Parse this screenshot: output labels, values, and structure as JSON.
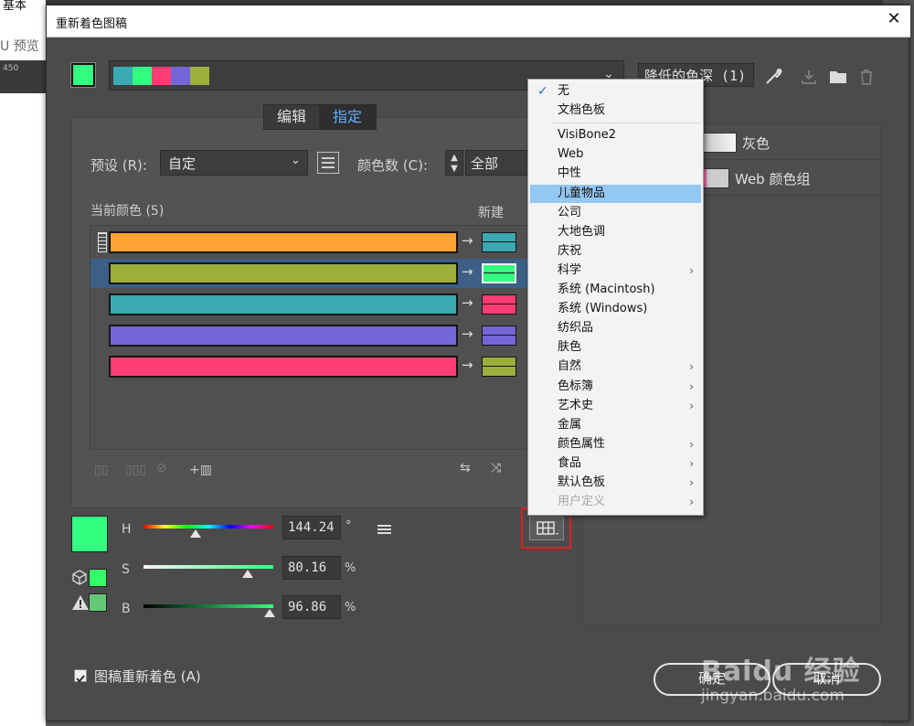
{
  "app": {
    "menu_label": "基本",
    "preview_label": "U 预览",
    "ruler_value": "450"
  },
  "dialog": {
    "title": "重新着色图稿",
    "close_glyph": "✕"
  },
  "harmony": {
    "reduce_label": "降低的色深 (1)",
    "swatch_colors": [
      "#3ba9b2",
      "#33ff80",
      "#ff3c74",
      "#7466d8",
      "#9dae3c"
    ]
  },
  "tabs": [
    {
      "label": "编辑",
      "active": false
    },
    {
      "label": "指定",
      "active": true
    }
  ],
  "preset": {
    "label": "预设 (R):",
    "value": "自定",
    "colors_label": "颜色数 (C):",
    "colors_value": "全部"
  },
  "columns": {
    "current": "当前颜色 (5)",
    "new": "新建"
  },
  "color_rows": [
    {
      "current": "#ffa133",
      "new_top": "#3ba9b2",
      "new_bottom": "#3ba9b2",
      "selected": false
    },
    {
      "current": "#9dae3c",
      "new_top": "#33ff80",
      "new_bottom": "#33ff80",
      "selected": true
    },
    {
      "current": "#3ba9b2",
      "new_top": "#ff3c74",
      "new_bottom": "#ff3c74",
      "selected": false
    },
    {
      "current": "#7466d8",
      "new_top": "#7466d8",
      "new_bottom": "#7466d8",
      "selected": false
    },
    {
      "current": "#ff3c74",
      "new_top": "#9dae3c",
      "new_bottom": "#9dae3c",
      "selected": false
    }
  ],
  "hsb": {
    "active_color": "#33ff80",
    "h_label": "H",
    "h_value": "144.24",
    "h_unit": "°",
    "s_label": "S",
    "s_value": "80.16",
    "s_unit": "%",
    "b_label": "B",
    "b_value": "96.86",
    "b_unit": "%",
    "h_level": 0.4,
    "s_level": 0.8016,
    "b_level": 0.9686
  },
  "right_panel": {
    "groups": [
      {
        "label": "灰色"
      },
      {
        "label": "Web 颜色组"
      }
    ]
  },
  "recolor_checkbox": {
    "label": "图稿重新着色 (A)",
    "checked": true
  },
  "buttons": {
    "ok": "确定",
    "cancel": "取消"
  },
  "watermark": {
    "brand": "Baidu 经验",
    "url": "jingyan.baidu.com"
  },
  "library_menu": {
    "items": [
      {
        "label": "无",
        "checked": true,
        "submenu": false,
        "highlighted": false,
        "disabled": false
      },
      {
        "label": "文档色板",
        "checked": false,
        "submenu": false,
        "highlighted": false,
        "disabled": false
      },
      {
        "label": "VisiBone2",
        "checked": false,
        "submenu": false,
        "highlighted": false,
        "disabled": false
      },
      {
        "label": "Web",
        "checked": false,
        "submenu": false,
        "highlighted": false,
        "disabled": false
      },
      {
        "label": "中性",
        "checked": false,
        "submenu": false,
        "highlighted": false,
        "disabled": false
      },
      {
        "label": "儿童物品",
        "checked": false,
        "submenu": false,
        "highlighted": true,
        "disabled": false
      },
      {
        "label": "公司",
        "checked": false,
        "submenu": false,
        "highlighted": false,
        "disabled": false
      },
      {
        "label": "大地色调",
        "checked": false,
        "submenu": false,
        "highlighted": false,
        "disabled": false
      },
      {
        "label": "庆祝",
        "checked": false,
        "submenu": false,
        "highlighted": false,
        "disabled": false
      },
      {
        "label": "科学",
        "checked": false,
        "submenu": true,
        "highlighted": false,
        "disabled": false
      },
      {
        "label": "系统 (Macintosh)",
        "checked": false,
        "submenu": false,
        "highlighted": false,
        "disabled": false
      },
      {
        "label": "系统 (Windows)",
        "checked": false,
        "submenu": false,
        "highlighted": false,
        "disabled": false
      },
      {
        "label": "纺织品",
        "checked": false,
        "submenu": false,
        "highlighted": false,
        "disabled": false
      },
      {
        "label": "肤色",
        "checked": false,
        "submenu": false,
        "highlighted": false,
        "disabled": false
      },
      {
        "label": "自然",
        "checked": false,
        "submenu": true,
        "highlighted": false,
        "disabled": false
      },
      {
        "label": "色标簿",
        "checked": false,
        "submenu": true,
        "highlighted": false,
        "disabled": false
      },
      {
        "label": "艺术史",
        "checked": false,
        "submenu": true,
        "highlighted": false,
        "disabled": false
      },
      {
        "label": "金属",
        "checked": false,
        "submenu": false,
        "highlighted": false,
        "disabled": false
      },
      {
        "label": "颜色属性",
        "checked": false,
        "submenu": true,
        "highlighted": false,
        "disabled": false
      },
      {
        "label": "食品",
        "checked": false,
        "submenu": true,
        "highlighted": false,
        "disabled": false
      },
      {
        "label": "默认色板",
        "checked": false,
        "submenu": true,
        "highlighted": false,
        "disabled": false
      },
      {
        "label": "用户定义",
        "checked": false,
        "submenu": true,
        "highlighted": false,
        "disabled": true
      }
    ]
  },
  "colors": {
    "dialog_bg": "#4b4b4b",
    "highlight_box": "#e02020",
    "menu_highlight": "#94c7f1"
  }
}
